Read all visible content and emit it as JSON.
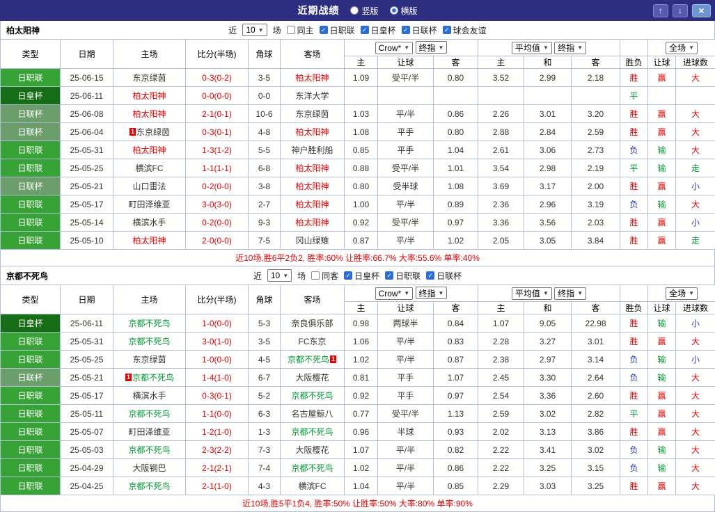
{
  "titlebar": {
    "title": "近期战绩",
    "mode_vertical": "竖版",
    "mode_horizontal": "横版",
    "selected_mode": "横版",
    "up_button": "↑",
    "down_button": "↓",
    "close_button": "×"
  },
  "table_header": {
    "type": "类型",
    "date": "日期",
    "home": "主场",
    "score": "比分(半场)",
    "corner": "角球",
    "away": "客场",
    "asia_company": "Crow*",
    "asia_final": "终指",
    "euro_company": "平均值",
    "euro_final": "终指",
    "scope": "全场",
    "sub_home": "主",
    "sub_handicap": "让球",
    "sub_away": "客",
    "sub_draw": "和",
    "result": "胜负",
    "handicap_result": "让球",
    "goals": "进球数"
  },
  "colors": {
    "titlebar_bg": "#2e2e80",
    "border": "#b1bfd7",
    "score": "#e60000",
    "summary": "#e60000",
    "league": {
      "日职联": "#37a337",
      "日皇杯": "#156e15",
      "日联杯": "#6b9e6b"
    },
    "result": {
      "胜": "#e60000",
      "平": "#009933",
      "负": "#2540c0"
    },
    "handicap": {
      "赢": "#e60000",
      "输": "#009933",
      "走": "#2540c0"
    },
    "goals": {
      "大": "#e60000",
      "小": "#2540c0",
      "走": "#009933"
    }
  },
  "sections": [
    {
      "team": "柏太阳神",
      "focus_color": "#e60000",
      "filter": {
        "prefix": "近",
        "count": "10",
        "suffix": "场",
        "same": "同主",
        "leagues": [
          "日职联",
          "日皇杯",
          "日联杯",
          "球会友谊"
        ]
      },
      "rows": [
        {
          "lg": "日职联",
          "date": "25-06-15",
          "home": "东京绿茵",
          "score": "0-3(0-2)",
          "cor": "3-5",
          "away": "柏太阳神",
          "o": [
            "1.09",
            "受平/半",
            "0.80",
            "3.52",
            "2.99",
            "2.18"
          ],
          "r": "胜",
          "hr": "赢",
          "g": "大"
        },
        {
          "lg": "日皇杯",
          "date": "25-06-11",
          "home": "柏太阳神",
          "score": "0-0(0-0)",
          "cor": "0-0",
          "away": "东洋大学",
          "o": [
            "",
            "",
            "",
            "",
            "",
            ""
          ],
          "r": "平",
          "hr": "",
          "g": ""
        },
        {
          "lg": "日联杯",
          "date": "25-06-08",
          "home": "柏太阳神",
          "score": "2-1(0-1)",
          "cor": "10-6",
          "away": "东京绿茵",
          "o": [
            "1.03",
            "平/半",
            "0.86",
            "2.26",
            "3.01",
            "3.20"
          ],
          "r": "胜",
          "hr": "赢",
          "g": "大"
        },
        {
          "lg": "日联杯",
          "date": "25-06-04",
          "home": "东京绿茵",
          "hm": "1",
          "score": "0-3(0-1)",
          "cor": "4-8",
          "away": "柏太阳神",
          "o": [
            "1.08",
            "平手",
            "0.80",
            "2.88",
            "2.84",
            "2.59"
          ],
          "r": "胜",
          "hr": "赢",
          "g": "大"
        },
        {
          "lg": "日职联",
          "date": "25-05-31",
          "home": "柏太阳神",
          "score": "1-3(1-2)",
          "cor": "5-5",
          "away": "神户胜利船",
          "o": [
            "0.85",
            "平手",
            "1.04",
            "2.61",
            "3.06",
            "2.73"
          ],
          "r": "负",
          "hr": "输",
          "g": "大"
        },
        {
          "lg": "日职联",
          "date": "25-05-25",
          "home": "横滨FC",
          "score": "1-1(1-1)",
          "cor": "6-8",
          "away": "柏太阳神",
          "o": [
            "0.88",
            "受平/半",
            "1.01",
            "3.54",
            "2.98",
            "2.19"
          ],
          "r": "平",
          "hr": "输",
          "g": "走"
        },
        {
          "lg": "日联杯",
          "date": "25-05-21",
          "home": "山口雷法",
          "score": "0-2(0-0)",
          "cor": "3-8",
          "away": "柏太阳神",
          "o": [
            "0.80",
            "受半球",
            "1.08",
            "3.69",
            "3.17",
            "2.00"
          ],
          "r": "胜",
          "hr": "赢",
          "g": "小"
        },
        {
          "lg": "日职联",
          "date": "25-05-17",
          "home": "町田泽维亚",
          "score": "3-0(3-0)",
          "cor": "2-7",
          "away": "柏太阳神",
          "o": [
            "1.00",
            "平/半",
            "0.89",
            "2.36",
            "2.96",
            "3.19"
          ],
          "r": "负",
          "hr": "输",
          "g": "大"
        },
        {
          "lg": "日职联",
          "date": "25-05-14",
          "home": "横滨水手",
          "score": "0-2(0-0)",
          "cor": "9-3",
          "away": "柏太阳神",
          "o": [
            "0.92",
            "受平/半",
            "0.97",
            "3.36",
            "3.56",
            "2.03"
          ],
          "r": "胜",
          "hr": "赢",
          "g": "小"
        },
        {
          "lg": "日职联",
          "date": "25-05-10",
          "home": "柏太阳神",
          "score": "2-0(0-0)",
          "cor": "7-5",
          "away": "冈山绿雉",
          "o": [
            "0.87",
            "平/半",
            "1.02",
            "2.05",
            "3.05",
            "3.84"
          ],
          "r": "胜",
          "hr": "赢",
          "g": "走"
        }
      ],
      "summary": "近10场,胜6平2负2, 胜率:60% 让胜率:66.7% 大率:55.6% 单率:40%"
    },
    {
      "team": "京都不死鸟",
      "focus_color": "#009933",
      "filter": {
        "prefix": "近",
        "count": "10",
        "suffix": "场",
        "same": "同客",
        "leagues": [
          "日皇杯",
          "日职联",
          "日联杯"
        ]
      },
      "rows": [
        {
          "lg": "日皇杯",
          "date": "25-06-11",
          "home": "京都不死鸟",
          "score": "1-0(0-0)",
          "cor": "5-3",
          "away": "奈良俱乐部",
          "o": [
            "0.98",
            "两球半",
            "0.84",
            "1.07",
            "9.05",
            "22.98"
          ],
          "r": "胜",
          "hr": "输",
          "g": "小"
        },
        {
          "lg": "日职联",
          "date": "25-05-31",
          "home": "京都不死鸟",
          "score": "3-0(1-0)",
          "cor": "3-5",
          "away": "FC东京",
          "o": [
            "1.06",
            "平/半",
            "0.83",
            "2.28",
            "3.27",
            "3.01"
          ],
          "r": "胜",
          "hr": "赢",
          "g": "大"
        },
        {
          "lg": "日职联",
          "date": "25-05-25",
          "home": "东京绿茵",
          "score": "1-0(0-0)",
          "cor": "4-5",
          "away": "京都不死鸟",
          "ama": "1",
          "o": [
            "1.02",
            "平/半",
            "0.87",
            "2.38",
            "2.97",
            "3.14"
          ],
          "r": "负",
          "hr": "输",
          "g": "小"
        },
        {
          "lg": "日联杯",
          "date": "25-05-21",
          "home": "京都不死鸟",
          "hm": "1",
          "score": "1-4(1-0)",
          "cor": "6-7",
          "away": "大阪樱花",
          "o": [
            "0.81",
            "平手",
            "1.07",
            "2.45",
            "3.30",
            "2.64"
          ],
          "r": "负",
          "hr": "输",
          "g": "大"
        },
        {
          "lg": "日职联",
          "date": "25-05-17",
          "home": "横滨水手",
          "score": "0-3(0-1)",
          "cor": "5-2",
          "away": "京都不死鸟",
          "o": [
            "0.92",
            "平手",
            "0.97",
            "2.54",
            "3.36",
            "2.60"
          ],
          "r": "胜",
          "hr": "赢",
          "g": "大"
        },
        {
          "lg": "日职联",
          "date": "25-05-11",
          "home": "京都不死鸟",
          "score": "1-1(0-0)",
          "cor": "6-3",
          "away": "名古屋鲸八",
          "o": [
            "0.77",
            "受平/半",
            "1.13",
            "2.59",
            "3.02",
            "2.82"
          ],
          "r": "平",
          "hr": "赢",
          "g": "大"
        },
        {
          "lg": "日职联",
          "date": "25-05-07",
          "home": "町田泽维亚",
          "score": "1-2(1-0)",
          "cor": "1-3",
          "away": "京都不死鸟",
          "o": [
            "0.96",
            "半球",
            "0.93",
            "2.02",
            "3.13",
            "3.86"
          ],
          "r": "胜",
          "hr": "赢",
          "g": "大"
        },
        {
          "lg": "日职联",
          "date": "25-05-03",
          "home": "京都不死鸟",
          "score": "2-3(2-2)",
          "cor": "7-3",
          "away": "大阪樱花",
          "o": [
            "1.07",
            "平/半",
            "0.82",
            "2.22",
            "3.41",
            "3.02"
          ],
          "r": "负",
          "hr": "输",
          "g": "大"
        },
        {
          "lg": "日职联",
          "date": "25-04-29",
          "home": "大阪钢巴",
          "score": "2-1(2-1)",
          "cor": "7-4",
          "away": "京都不死鸟",
          "o": [
            "1.02",
            "平/半",
            "0.86",
            "2.22",
            "3.25",
            "3.15"
          ],
          "r": "负",
          "hr": "输",
          "g": "大"
        },
        {
          "lg": "日职联",
          "date": "25-04-25",
          "home": "京都不死鸟",
          "score": "2-1(1-0)",
          "cor": "4-3",
          "away": "横滨FC",
          "o": [
            "1.04",
            "平/半",
            "0.85",
            "2.29",
            "3.03",
            "3.25"
          ],
          "r": "胜",
          "hr": "赢",
          "g": "大"
        }
      ],
      "summary": "近10场,胜5平1负4, 胜率:50% 让胜率:50% 大率:80% 单率:90%"
    }
  ]
}
